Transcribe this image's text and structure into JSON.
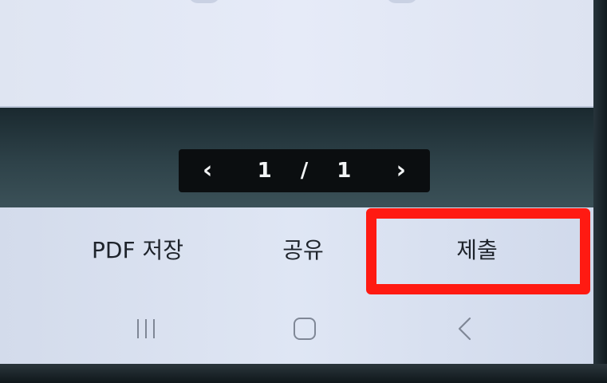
{
  "pager": {
    "current": "1",
    "separator": "/",
    "total": "1",
    "prev_glyph": "‹",
    "next_glyph": "›"
  },
  "actions": {
    "pdf_save": "PDF 저장",
    "share": "공유",
    "submit": "제출"
  },
  "highlight_color": "#ff1a12",
  "system_nav": {
    "recents_icon": "recents-icon",
    "home_icon": "home-icon",
    "back_icon": "back-icon"
  }
}
